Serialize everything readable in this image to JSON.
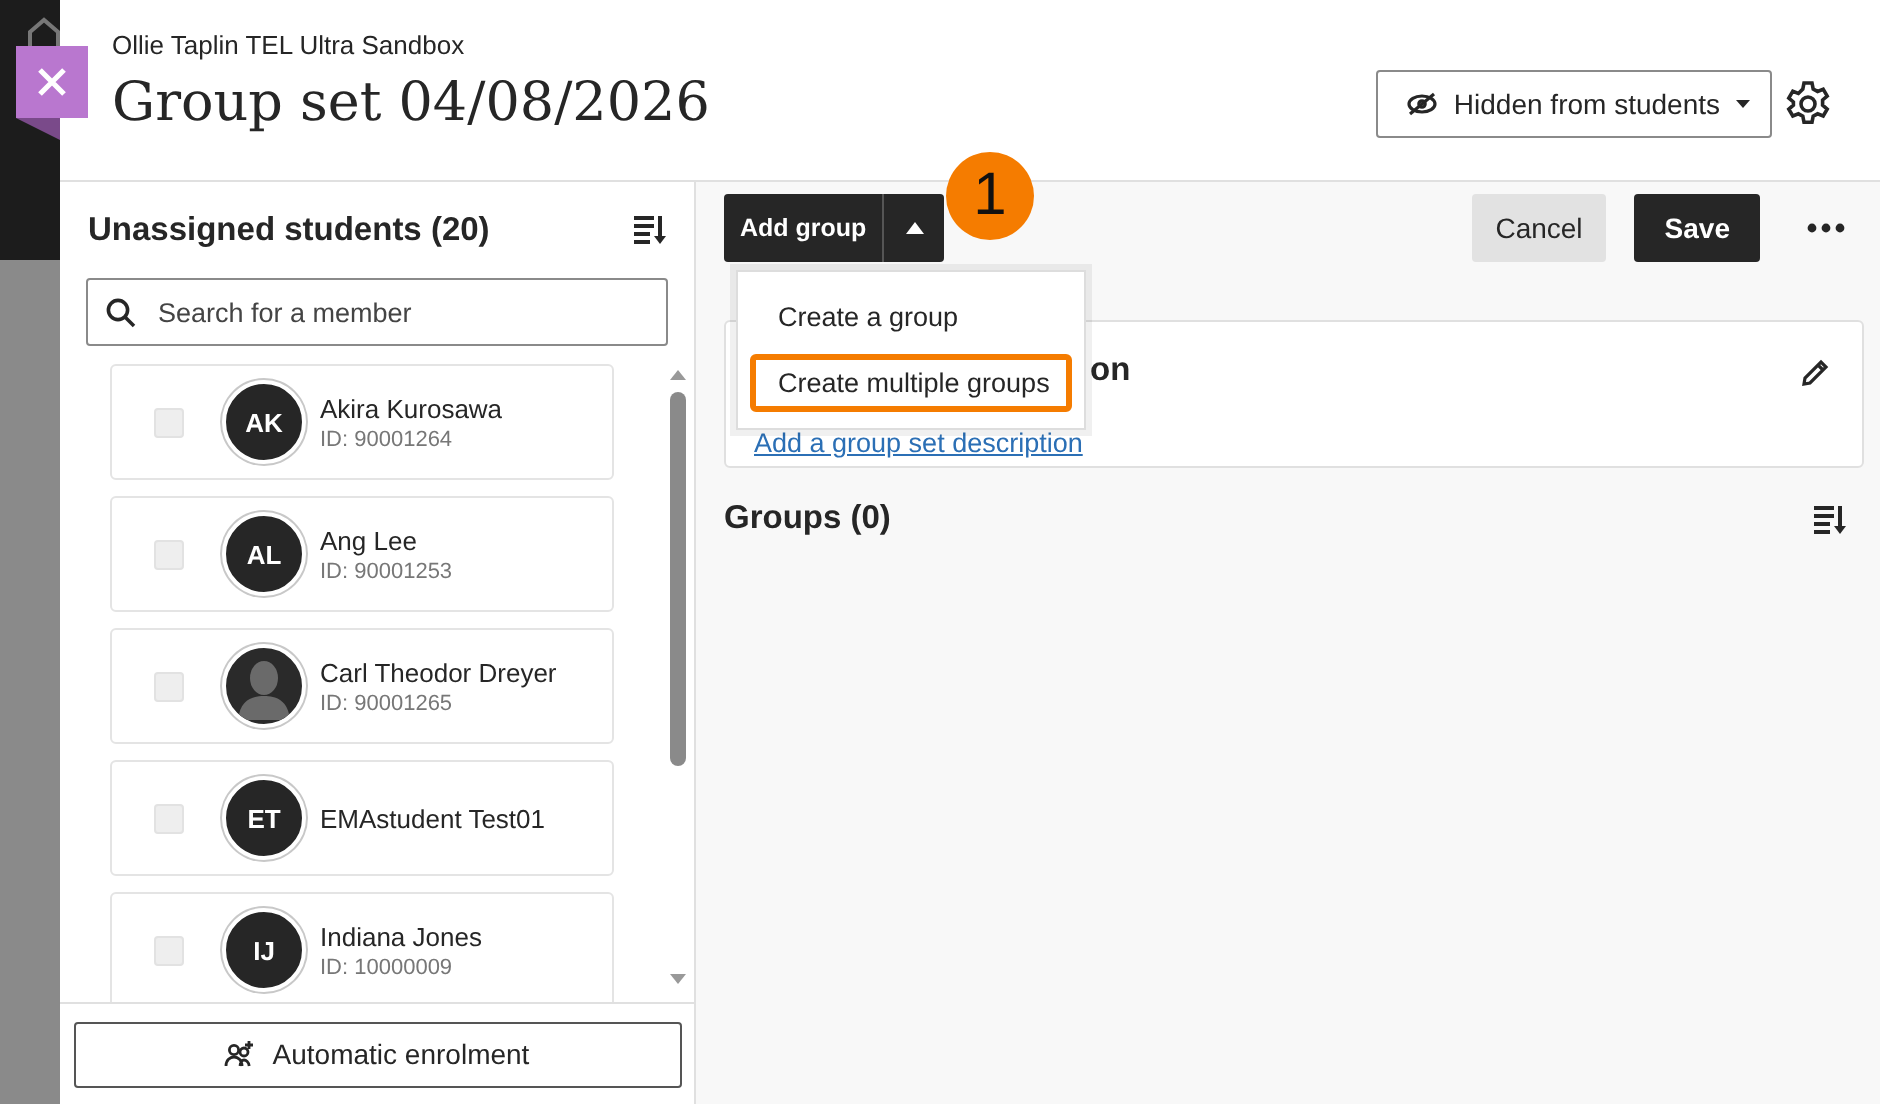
{
  "header": {
    "course": "Ollie Taplin TEL Ultra Sandbox",
    "title": "Group set 04/08/2026",
    "visibility": "Hidden from students"
  },
  "unassigned": {
    "title": "Unassigned students (20)",
    "search": {
      "placeholder": "Search for a member"
    },
    "students": [
      {
        "name": "Akira Kurosawa",
        "id": "ID: 90001264",
        "kind": "initials",
        "initials": "AK",
        "checked": false
      },
      {
        "name": "Ang Lee",
        "id": "ID: 90001253",
        "kind": "initials",
        "initials": "AL",
        "checked": false
      },
      {
        "name": "Carl Theodor Dreyer",
        "id": "ID: 90001265",
        "kind": "silhouette",
        "checked": false
      },
      {
        "name": "EMAstudent Test01",
        "kind": "initials",
        "initials": "ET",
        "checked": false
      },
      {
        "name": "Indiana Jones",
        "id": "ID: 10000009",
        "kind": "initials",
        "initials": "IJ",
        "checked": false
      }
    ],
    "auto_button": "Automatic enrolment"
  },
  "toolbar": {
    "add_group": "Add group",
    "cancel": "Cancel",
    "save": "Save"
  },
  "menu": {
    "items": [
      {
        "label": "Create a group",
        "highlighted": false
      },
      {
        "label": "Create multiple groups",
        "highlighted": true
      }
    ]
  },
  "callout": "1",
  "description_card": {
    "title_fragment": "on",
    "link": "Add a group set description"
  },
  "groups": {
    "title": "Groups (0)"
  }
}
